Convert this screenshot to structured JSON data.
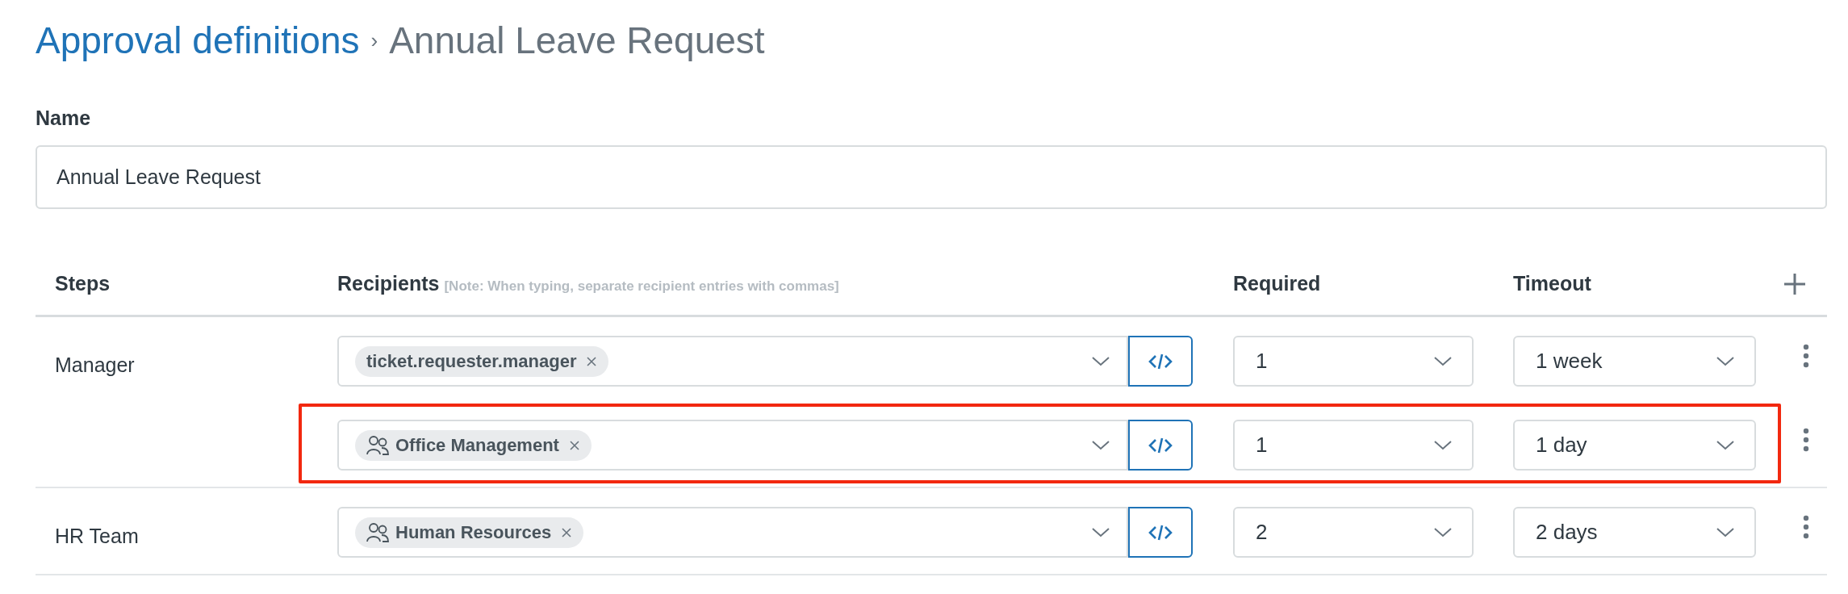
{
  "breadcrumb": {
    "parent": "Approval definitions",
    "separator": "›",
    "current": "Annual Leave Request"
  },
  "name_field": {
    "label": "Name",
    "value": "Annual Leave Request"
  },
  "table": {
    "columns": {
      "steps": "Steps",
      "recipients": "Recipients",
      "recipients_note": "[Note: When typing, separate recipient entries with commas]",
      "required": "Required",
      "timeout": "Timeout"
    },
    "steps": [
      {
        "name": "Manager",
        "recipients": [
          {
            "chips": [
              {
                "label": "ticket.requester.manager",
                "kind": "expression"
              }
            ],
            "required": "1",
            "timeout": "1 week",
            "highlighted": false
          },
          {
            "chips": [
              {
                "label": "Office Management",
                "kind": "group"
              }
            ],
            "required": "1",
            "timeout": "1 day",
            "highlighted": true
          }
        ]
      },
      {
        "name": "HR Team",
        "recipients": [
          {
            "chips": [
              {
                "label": "Human Resources",
                "kind": "group"
              }
            ],
            "required": "2",
            "timeout": "2 days",
            "highlighted": false
          }
        ]
      }
    ]
  }
}
